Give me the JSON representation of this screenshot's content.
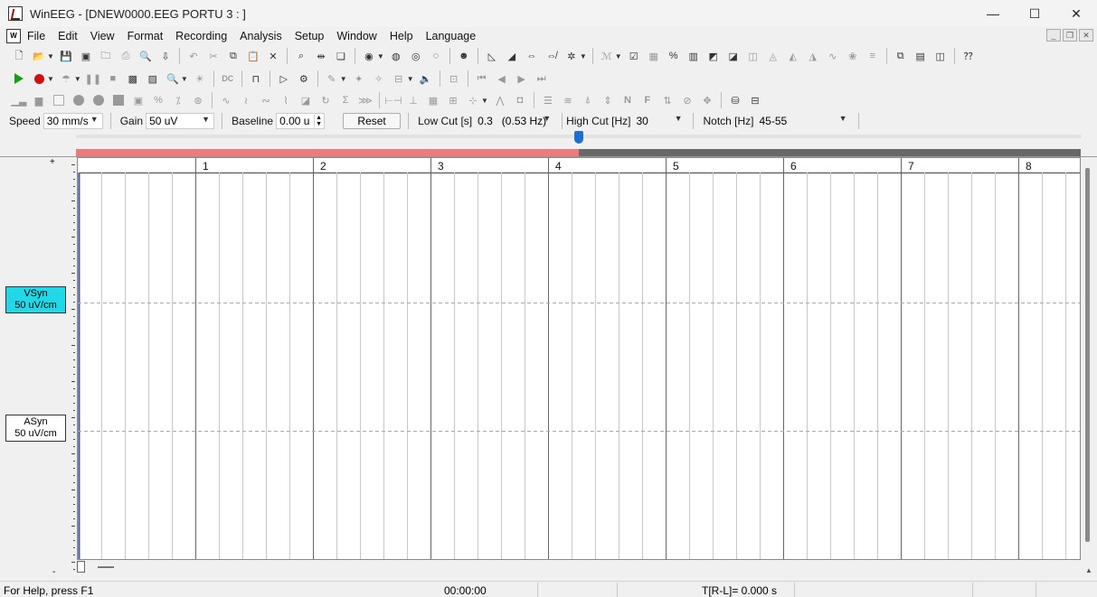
{
  "window": {
    "title": "WinEEG - [DNEW0000.EEG PORTU 3 : ]",
    "minimize_glyph": "—",
    "maximize_glyph": "☐",
    "close_glyph": "✕"
  },
  "menu": {
    "items": [
      "File",
      "Edit",
      "View",
      "Format",
      "Recording",
      "Analysis",
      "Setup",
      "Window",
      "Help",
      "Language"
    ]
  },
  "params": {
    "speed_label": "Speed",
    "speed_value": "30 mm/s",
    "gain_label": "Gain",
    "gain_value": "50 uV",
    "baseline_label": "Baseline",
    "baseline_value": "0.00 u",
    "reset_label": "Reset",
    "lowcut_label": "Low Cut [s]",
    "lowcut_value": "0.3   (0.53 Hz)",
    "highcut_label": "High Cut [Hz]",
    "highcut_value": "30",
    "notch_label": "Notch [Hz]",
    "notch_value": "45-55"
  },
  "record": {
    "progress_fraction": 0.5,
    "slider_fraction": 0.5,
    "second_markers": [
      "1",
      "2",
      "3",
      "4",
      "5",
      "6",
      "7",
      "8"
    ]
  },
  "channels": [
    {
      "name": "VSyn",
      "scale": "50 uV/cm",
      "selected": true
    },
    {
      "name": "ASyn",
      "scale": "50 uV/cm",
      "selected": false
    }
  ],
  "scale_plus": "+",
  "scale_minus": "-",
  "status": {
    "help": "For Help, press F1",
    "time": "00:00:00",
    "interval": "T[R-L]= 0.000 s"
  },
  "colors": {
    "selected_channel": "#22d8e6",
    "progress_fill": "#f07a7a",
    "progress_bg": "#686868",
    "slider_thumb": "#1e6fd0"
  }
}
